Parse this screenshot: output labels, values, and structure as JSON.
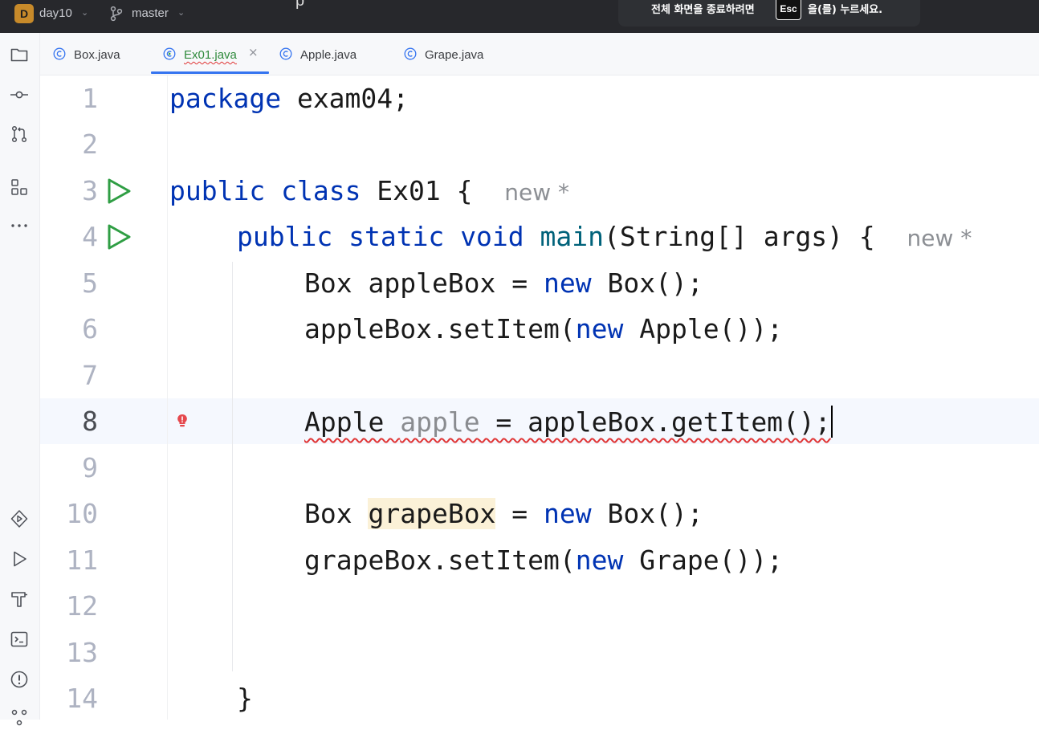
{
  "titlebar": {
    "project_initial": "D",
    "project_name": "day10",
    "branch": "master",
    "title_fragment": "p",
    "toast": {
      "before": "전체 화면을 종료하려면",
      "key": "Esc",
      "after": "을(를) 누르세요."
    }
  },
  "tabs": [
    {
      "label": "Box.java"
    },
    {
      "label": "Ex01.java"
    },
    {
      "label": "Apple.java"
    },
    {
      "label": "Grape.java"
    }
  ],
  "tab_close": "×",
  "editor": {
    "line_numbers": [
      "1",
      "2",
      "3",
      "4",
      "5",
      "6",
      "7",
      "8",
      "9",
      "10",
      "11",
      "12",
      "13",
      "14"
    ],
    "hint_new": "new *",
    "code": {
      "l1_kw": "package",
      "l1_rest": " exam04;",
      "l3_kw1": "public",
      "l3_kw2": "class",
      "l3_rest": " Ex01 {",
      "l4_kw1": "public",
      "l4_kw2": "static",
      "l4_kw3": "void",
      "l4_fn": "main",
      "l4_rest": "(String[] args) {",
      "l5_a": "Box appleBox = ",
      "l5_kw": "new",
      "l5_b": " Box();",
      "l6_a": "appleBox.setItem(",
      "l6_kw": "new",
      "l6_b": " Apple());",
      "l8_a": "Apple ",
      "l8_var": "apple",
      "l8_b": " = appleBox.getItem();",
      "l10_a": "Box ",
      "l10_var": "grapeBox",
      "l10_b": " = ",
      "l10_kw": "new",
      "l10_c": " Box();",
      "l11_a": "grapeBox.setItem(",
      "l11_kw": "new",
      "l11_b": " Grape());",
      "l14": "}"
    }
  },
  "colors": {
    "keyword": "#0033b3",
    "method": "#00627a",
    "error_underline": "#e03636",
    "run_icon": "#2f9e44",
    "active_tab_underline": "#3574f0"
  },
  "icons": {
    "toolstrip": [
      "folder-icon",
      "commit-icon",
      "pull-requests-icon",
      "structure-icon",
      "more-icon",
      "services-icon",
      "run-icon",
      "build-icon",
      "terminal-icon",
      "problems-icon",
      "git-icon"
    ],
    "tabs": "java-class-icon"
  }
}
